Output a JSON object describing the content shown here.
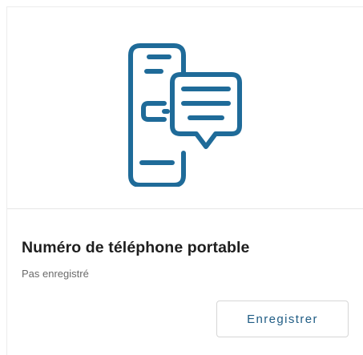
{
  "card": {
    "icon": "mobile-phone-chat-icon",
    "title": "Numéro de téléphone portable",
    "status": "Pas enregistré",
    "button_label": "Enregistrer"
  },
  "colors": {
    "icon": "#1f6b99",
    "title": "#1e1e1e",
    "status": "#6a6a6a",
    "button_text": "#1f5c84",
    "button_border": "#d6d6d6",
    "divider": "#e6e6e6"
  }
}
